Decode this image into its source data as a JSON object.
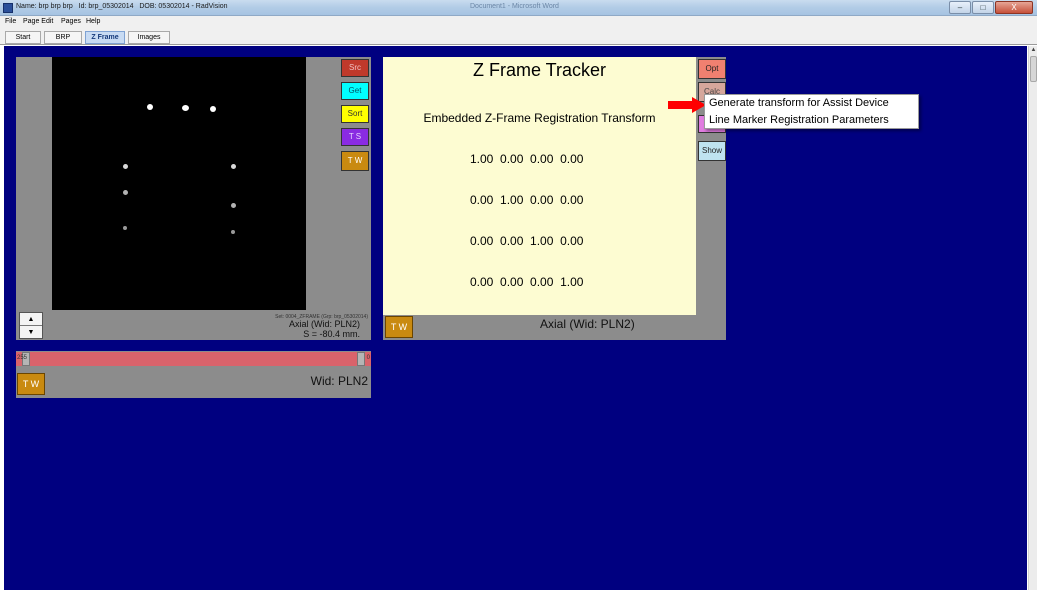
{
  "window": {
    "title": "Name: brp brp brp   Id: brp_05302014   DOB: 05302014 - RadVision",
    "ghost_title": "Document1 - Microsoft Word",
    "controls": {
      "minimize": "–",
      "maximize": "□",
      "close": "X"
    }
  },
  "menubar": {
    "items": [
      "File",
      "Page Edit",
      "Pages",
      "Help"
    ]
  },
  "tabs": [
    {
      "label": "Start",
      "active": false
    },
    {
      "label": "BRP",
      "active": false
    },
    {
      "label": "Z Frame",
      "active": true
    },
    {
      "label": "Images",
      "active": false
    }
  ],
  "image_panel": {
    "buttons": {
      "src": "Src",
      "get": "Get",
      "sort": "Sort",
      "ts": "T S",
      "tw": "T W"
    },
    "set_info": "Set: 0004_ZFRAME (Grp: brp_05302014)",
    "axial_info": "Axial (Wid: PLN2)",
    "slice_info": "S = -80.4 mm.",
    "stepper": {
      "up": "▲",
      "down": "▼"
    }
  },
  "window_level": {
    "left_value": "255",
    "right_value": "0",
    "tw": "T W",
    "label": "Wid: PLN2"
  },
  "zframe": {
    "title": "Z Frame Tracker",
    "subtitle": "Embedded Z-Frame Registration Transform",
    "matrix_rows": [
      "1.00  0.00  0.00  0.00",
      "0.00  1.00  0.00  0.00",
      "0.00  0.00  1.00  0.00",
      "0.00  0.00  0.00  1.00"
    ],
    "axial_label": "Axial (Wid: PLN2)",
    "tw": "T W",
    "buttons": {
      "opt": "Opt",
      "calc": "Calc",
      "show": "Show"
    }
  },
  "context_menu": {
    "items": [
      "Generate transform for Assist Device",
      "Line Marker Registration Parameters"
    ]
  },
  "colors": {
    "workspace": "#000080",
    "panel": "#8c8c8c",
    "zframe_bg": "#fdfcd2",
    "src_btn": "#c0392b",
    "get_btn": "#00ffff",
    "sort_btn": "#ffff00",
    "ts_btn": "#8a2be2",
    "tw_btn": "#c98a10",
    "opt_btn": "#f08070",
    "show_btn": "#bfe3f0",
    "wl_bar": "#d9636b",
    "arrow": "#ff0000"
  },
  "icons": {
    "app": "app-icon",
    "arrow": "red-pointer-arrow-icon"
  }
}
